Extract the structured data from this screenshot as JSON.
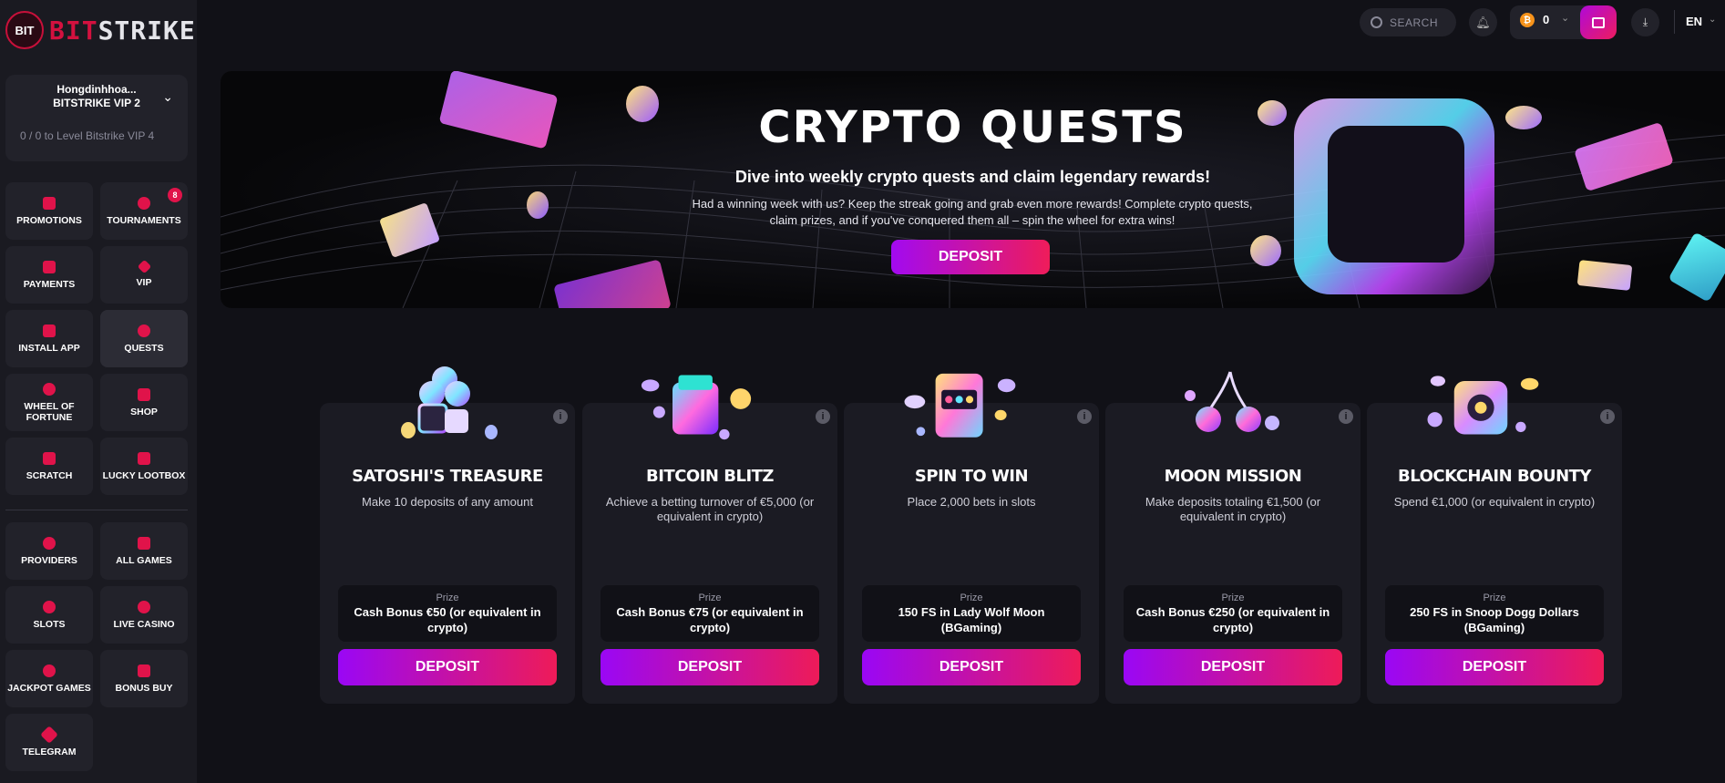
{
  "brand": {
    "logo_badge": "BIT",
    "logo_bit": "BIT",
    "logo_strike": "STRIKE",
    "accent": "#e0134a",
    "gradient_start": "#9a07f5",
    "gradient_end": "#ee1b58"
  },
  "user": {
    "name": "Hongdinhhoa...",
    "vip": "BITSTRIKE VIP 2",
    "progress": "0 / 0 to Level Bitstrike VIP 4"
  },
  "sidebar": {
    "menu": [
      {
        "label": "PROMOTIONS",
        "icon": "gift-icon"
      },
      {
        "label": "TOURNAMENTS",
        "icon": "trophy-icon",
        "badge": "8"
      },
      {
        "label": "PAYMENTS",
        "icon": "wallet-icon"
      },
      {
        "label": "VIP",
        "icon": "diamond-icon"
      },
      {
        "label": "INSTALL APP",
        "icon": "download-icon"
      },
      {
        "label": "QUESTS",
        "icon": "check-badge-icon"
      },
      {
        "label": "WHEEL OF FORTUNE",
        "icon": "wheel-icon"
      },
      {
        "label": "SHOP",
        "icon": "tag-icon"
      },
      {
        "label": "SCRATCH",
        "icon": "scratch-card-icon"
      },
      {
        "label": "LUCKY LOOTBOX",
        "icon": "lootbox-icon"
      }
    ],
    "games": [
      {
        "label": "PROVIDERS",
        "icon": "providers-icon"
      },
      {
        "label": "ALL GAMES",
        "icon": "grid-icon"
      },
      {
        "label": "SLOTS",
        "icon": "cherries-icon"
      },
      {
        "label": "LIVE CASINO",
        "icon": "spade-icon"
      },
      {
        "label": "JACKPOT GAMES",
        "icon": "jackpot-coin-icon"
      },
      {
        "label": "BONUS BUY",
        "icon": "crown-icon"
      },
      {
        "label": "TELEGRAM",
        "icon": "telegram-icon"
      }
    ]
  },
  "topbar": {
    "search_label": "SEARCH",
    "balance": "0",
    "currency_symbol": "₿",
    "language": "EN"
  },
  "hero": {
    "title": "CRYPTO QUESTS",
    "subtitle": "Dive into weekly crypto quests and claim legendary rewards!",
    "description": "Had a winning week with us? Keep the streak going and grab even more rewards! Complete crypto quests, claim prizes, and if you've conquered them all – spin the wheel for extra wins!",
    "deposit_label": "DEPOSIT"
  },
  "quests": [
    {
      "title": "SATOSHI'S TREASURE",
      "description": "Make 10 deposits of any amount",
      "prize_label": "Prize",
      "prize": "Cash Bonus €50 (or equivalent in crypto)",
      "button": "DEPOSIT",
      "art": "clover-dice-icon"
    },
    {
      "title": "BITCOIN BLITZ",
      "description": "Achieve a betting turnover of €5,000 (or equivalent in crypto)",
      "prize_label": "Prize",
      "prize": "Cash Bonus €75 (or equivalent in crypto)",
      "button": "DEPOSIT",
      "art": "wallet-coins-icon"
    },
    {
      "title": "SPIN TO WIN",
      "description": "Place 2,000 bets in slots",
      "prize_label": "Prize",
      "prize": "150 FS in Lady Wolf Moon (BGaming)",
      "button": "DEPOSIT",
      "art": "slot-machine-icon"
    },
    {
      "title": "MOON MISSION",
      "description": "Make deposits totaling €1,500 (or equivalent in crypto)",
      "prize_label": "Prize",
      "prize": "Cash Bonus €250 (or equivalent in crypto)",
      "button": "DEPOSIT",
      "art": "cherries-icon"
    },
    {
      "title": "BLOCKCHAIN BOUNTY",
      "description": "Spend €1,000 (or equivalent in crypto)",
      "prize_label": "Prize",
      "prize": "250 FS in Snoop Dogg Dollars (BGaming)",
      "button": "DEPOSIT",
      "art": "safe-icon"
    }
  ]
}
